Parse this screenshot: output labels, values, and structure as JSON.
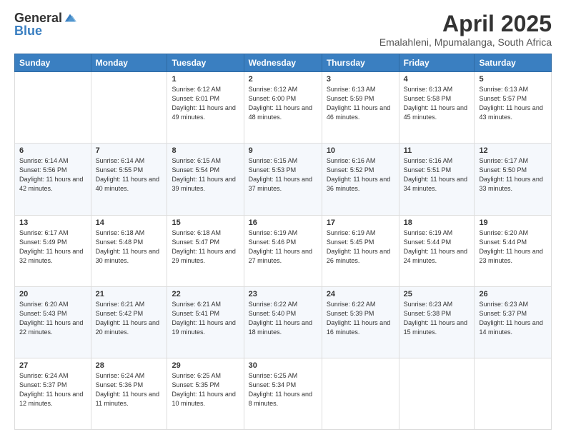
{
  "logo": {
    "general": "General",
    "blue": "Blue"
  },
  "title": "April 2025",
  "location": "Emalahleni, Mpumalanga, South Africa",
  "weekdays": [
    "Sunday",
    "Monday",
    "Tuesday",
    "Wednesday",
    "Thursday",
    "Friday",
    "Saturday"
  ],
  "weeks": [
    [
      null,
      null,
      {
        "day": "1",
        "sunrise": "6:12 AM",
        "sunset": "6:01 PM",
        "daylight": "11 hours and 49 minutes."
      },
      {
        "day": "2",
        "sunrise": "6:12 AM",
        "sunset": "6:00 PM",
        "daylight": "11 hours and 48 minutes."
      },
      {
        "day": "3",
        "sunrise": "6:13 AM",
        "sunset": "5:59 PM",
        "daylight": "11 hours and 46 minutes."
      },
      {
        "day": "4",
        "sunrise": "6:13 AM",
        "sunset": "5:58 PM",
        "daylight": "11 hours and 45 minutes."
      },
      {
        "day": "5",
        "sunrise": "6:13 AM",
        "sunset": "5:57 PM",
        "daylight": "11 hours and 43 minutes."
      }
    ],
    [
      {
        "day": "6",
        "sunrise": "6:14 AM",
        "sunset": "5:56 PM",
        "daylight": "11 hours and 42 minutes."
      },
      {
        "day": "7",
        "sunrise": "6:14 AM",
        "sunset": "5:55 PM",
        "daylight": "11 hours and 40 minutes."
      },
      {
        "day": "8",
        "sunrise": "6:15 AM",
        "sunset": "5:54 PM",
        "daylight": "11 hours and 39 minutes."
      },
      {
        "day": "9",
        "sunrise": "6:15 AM",
        "sunset": "5:53 PM",
        "daylight": "11 hours and 37 minutes."
      },
      {
        "day": "10",
        "sunrise": "6:16 AM",
        "sunset": "5:52 PM",
        "daylight": "11 hours and 36 minutes."
      },
      {
        "day": "11",
        "sunrise": "6:16 AM",
        "sunset": "5:51 PM",
        "daylight": "11 hours and 34 minutes."
      },
      {
        "day": "12",
        "sunrise": "6:17 AM",
        "sunset": "5:50 PM",
        "daylight": "11 hours and 33 minutes."
      }
    ],
    [
      {
        "day": "13",
        "sunrise": "6:17 AM",
        "sunset": "5:49 PM",
        "daylight": "11 hours and 32 minutes."
      },
      {
        "day": "14",
        "sunrise": "6:18 AM",
        "sunset": "5:48 PM",
        "daylight": "11 hours and 30 minutes."
      },
      {
        "day": "15",
        "sunrise": "6:18 AM",
        "sunset": "5:47 PM",
        "daylight": "11 hours and 29 minutes."
      },
      {
        "day": "16",
        "sunrise": "6:19 AM",
        "sunset": "5:46 PM",
        "daylight": "11 hours and 27 minutes."
      },
      {
        "day": "17",
        "sunrise": "6:19 AM",
        "sunset": "5:45 PM",
        "daylight": "11 hours and 26 minutes."
      },
      {
        "day": "18",
        "sunrise": "6:19 AM",
        "sunset": "5:44 PM",
        "daylight": "11 hours and 24 minutes."
      },
      {
        "day": "19",
        "sunrise": "6:20 AM",
        "sunset": "5:44 PM",
        "daylight": "11 hours and 23 minutes."
      }
    ],
    [
      {
        "day": "20",
        "sunrise": "6:20 AM",
        "sunset": "5:43 PM",
        "daylight": "11 hours and 22 minutes."
      },
      {
        "day": "21",
        "sunrise": "6:21 AM",
        "sunset": "5:42 PM",
        "daylight": "11 hours and 20 minutes."
      },
      {
        "day": "22",
        "sunrise": "6:21 AM",
        "sunset": "5:41 PM",
        "daylight": "11 hours and 19 minutes."
      },
      {
        "day": "23",
        "sunrise": "6:22 AM",
        "sunset": "5:40 PM",
        "daylight": "11 hours and 18 minutes."
      },
      {
        "day": "24",
        "sunrise": "6:22 AM",
        "sunset": "5:39 PM",
        "daylight": "11 hours and 16 minutes."
      },
      {
        "day": "25",
        "sunrise": "6:23 AM",
        "sunset": "5:38 PM",
        "daylight": "11 hours and 15 minutes."
      },
      {
        "day": "26",
        "sunrise": "6:23 AM",
        "sunset": "5:37 PM",
        "daylight": "11 hours and 14 minutes."
      }
    ],
    [
      {
        "day": "27",
        "sunrise": "6:24 AM",
        "sunset": "5:37 PM",
        "daylight": "11 hours and 12 minutes."
      },
      {
        "day": "28",
        "sunrise": "6:24 AM",
        "sunset": "5:36 PM",
        "daylight": "11 hours and 11 minutes."
      },
      {
        "day": "29",
        "sunrise": "6:25 AM",
        "sunset": "5:35 PM",
        "daylight": "11 hours and 10 minutes."
      },
      {
        "day": "30",
        "sunrise": "6:25 AM",
        "sunset": "5:34 PM",
        "daylight": "11 hours and 8 minutes."
      },
      null,
      null,
      null
    ]
  ],
  "labels": {
    "sunrise": "Sunrise:",
    "sunset": "Sunset:",
    "daylight": "Daylight:"
  }
}
